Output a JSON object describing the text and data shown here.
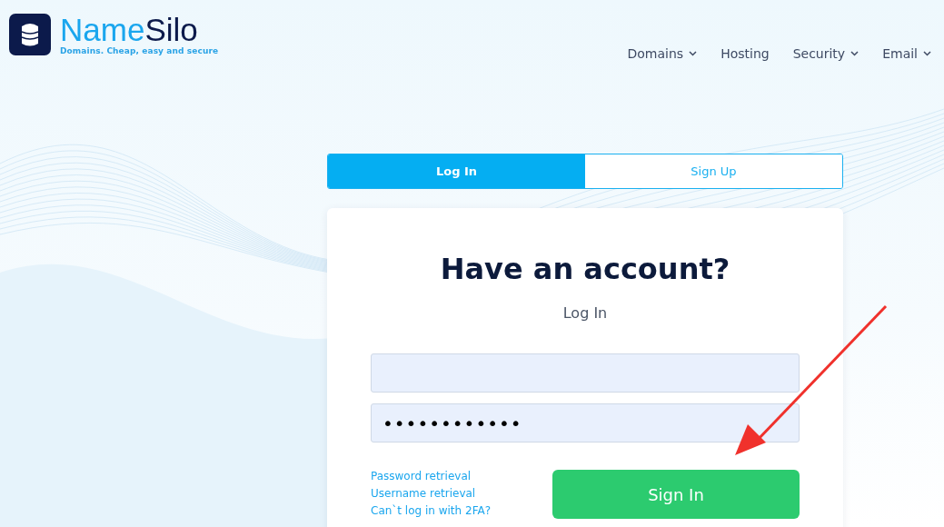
{
  "logo": {
    "name_first": "Name",
    "name_second": "Silo",
    "tagline": "Domains. Cheap, easy and secure"
  },
  "nav": [
    {
      "label": "Domains",
      "dropdown": true
    },
    {
      "label": "Hosting",
      "dropdown": false
    },
    {
      "label": "Security",
      "dropdown": true
    },
    {
      "label": "Email",
      "dropdown": true
    }
  ],
  "tabs": [
    {
      "label": "Log In",
      "selected": true
    },
    {
      "label": "Sign Up",
      "selected": false
    }
  ],
  "card": {
    "title": "Have an account?",
    "subtitle": "Log In",
    "password_value": "••••••••••••",
    "links": [
      "Password retrieval",
      "Username retrieval",
      "Can`t log in with 2FA?"
    ],
    "submit": "Sign In"
  }
}
